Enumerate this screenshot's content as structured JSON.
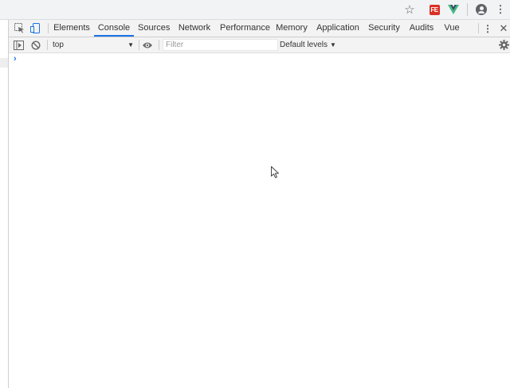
{
  "browser": {
    "icons": [
      "star-icon",
      "extension-fe-icon",
      "extension-vue-icon",
      "profile-icon",
      "more-vert-icon"
    ],
    "extension_fe_label": "FE",
    "star_glyph": "☆",
    "menu_glyph": "⋮"
  },
  "devtools": {
    "tabs": [
      {
        "label": "Elements",
        "active": false
      },
      {
        "label": "Console",
        "active": true
      },
      {
        "label": "Sources",
        "active": false
      },
      {
        "label": "Network",
        "active": false
      },
      {
        "label": "Performance",
        "active": false
      },
      {
        "label": "Memory",
        "active": false
      },
      {
        "label": "Application",
        "active": false
      },
      {
        "label": "Security",
        "active": false
      },
      {
        "label": "Audits",
        "active": false
      },
      {
        "label": "Vue",
        "active": false
      }
    ],
    "menu_glyph": "⋮",
    "close_glyph": "✕"
  },
  "console": {
    "context": "top",
    "context_arrow": "▼",
    "filter_placeholder": "Filter",
    "filter_value": "",
    "levels": "Default levels",
    "levels_arrow": "▼",
    "prompt_glyph": "›"
  },
  "colors": {
    "accent": "#1a73e8",
    "toolbar_bg": "#f3f3f3",
    "browser_bg": "#f1f3f4",
    "extension_fe": "#d93025",
    "vue_green": "#41b883",
    "vue_dark": "#35495e"
  }
}
